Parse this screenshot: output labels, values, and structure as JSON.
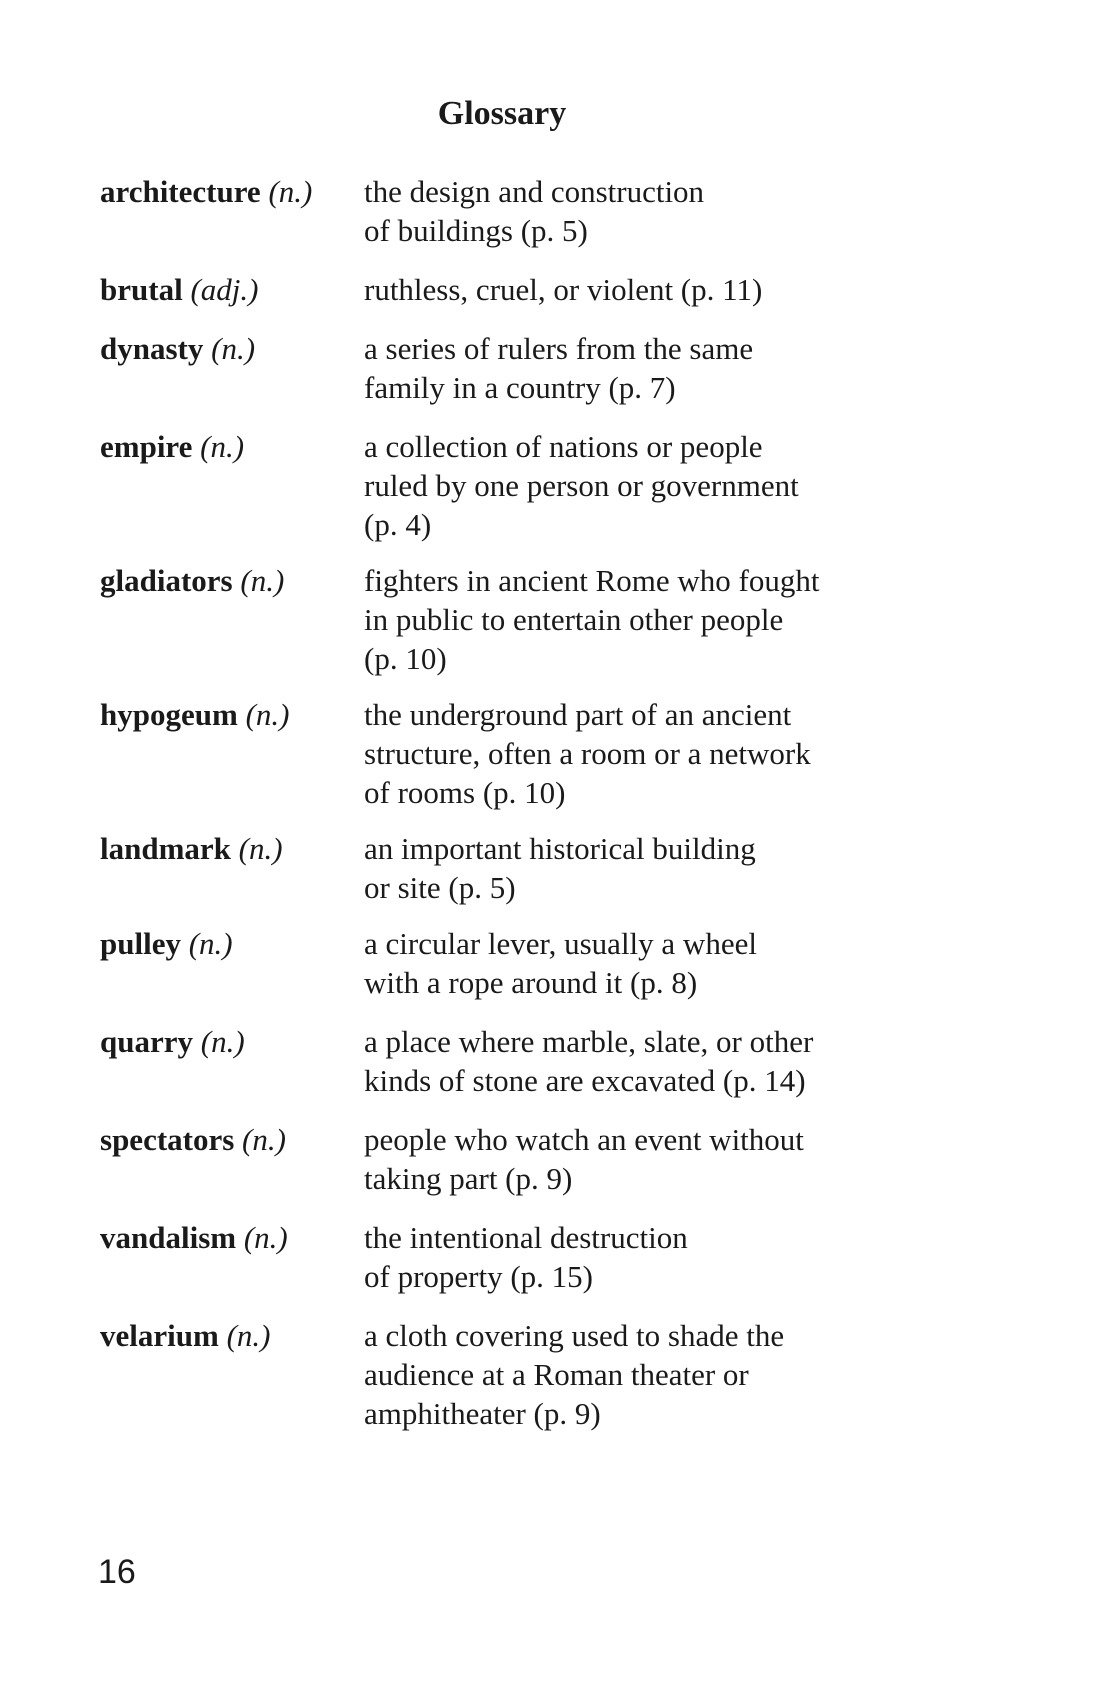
{
  "title": "Glossary",
  "entries": [
    {
      "term": "architecture",
      "pos": "(n.)",
      "definition": [
        "the design and construction",
        "of buildings (p. 5)"
      ]
    },
    {
      "term": "brutal",
      "pos": "(adj.)",
      "definition": [
        "ruthless, cruel, or violent (p. 11)"
      ]
    },
    {
      "term": "dynasty",
      "pos": "(n.)",
      "definition": [
        "a series of rulers from the same",
        "family in a country (p. 7)"
      ]
    },
    {
      "term": "empire",
      "pos": "(n.)",
      "definition": [
        "a collection of nations or people",
        "ruled by one person or government",
        "(p. 4)"
      ]
    },
    {
      "term": "gladiators",
      "pos": "(n.)",
      "definition": [
        "fighters in ancient Rome who fought",
        "in public to entertain other people",
        "(p. 10)"
      ]
    },
    {
      "term": "hypogeum",
      "pos": "(n.)",
      "definition": [
        "the underground part of an ancient",
        "structure, often a room or a network",
        "of rooms (p. 10)"
      ]
    },
    {
      "term": "landmark",
      "pos": "(n.)",
      "definition": [
        "an important historical building",
        "or site (p. 5)"
      ]
    },
    {
      "term": "pulley",
      "pos": "(n.)",
      "definition": [
        "a circular lever, usually a wheel",
        "with a rope around it (p. 8)"
      ]
    },
    {
      "term": "quarry",
      "pos": "(n.)",
      "definition": [
        "a place where marble, slate, or other",
        "kinds of stone are excavated (p. 14)"
      ]
    },
    {
      "term": "spectators",
      "pos": "(n.)",
      "definition": [
        "people who watch an event without",
        "taking part (p. 9)"
      ]
    },
    {
      "term": "vandalism",
      "pos": "(n.)",
      "definition": [
        "the intentional destruction",
        "of property (p. 15)"
      ]
    },
    {
      "term": "velarium",
      "pos": "(n.)",
      "definition": [
        "a cloth covering used to shade the",
        "audience at a Roman theater or",
        "amphitheater (p. 9)"
      ]
    }
  ],
  "page_number": "16"
}
